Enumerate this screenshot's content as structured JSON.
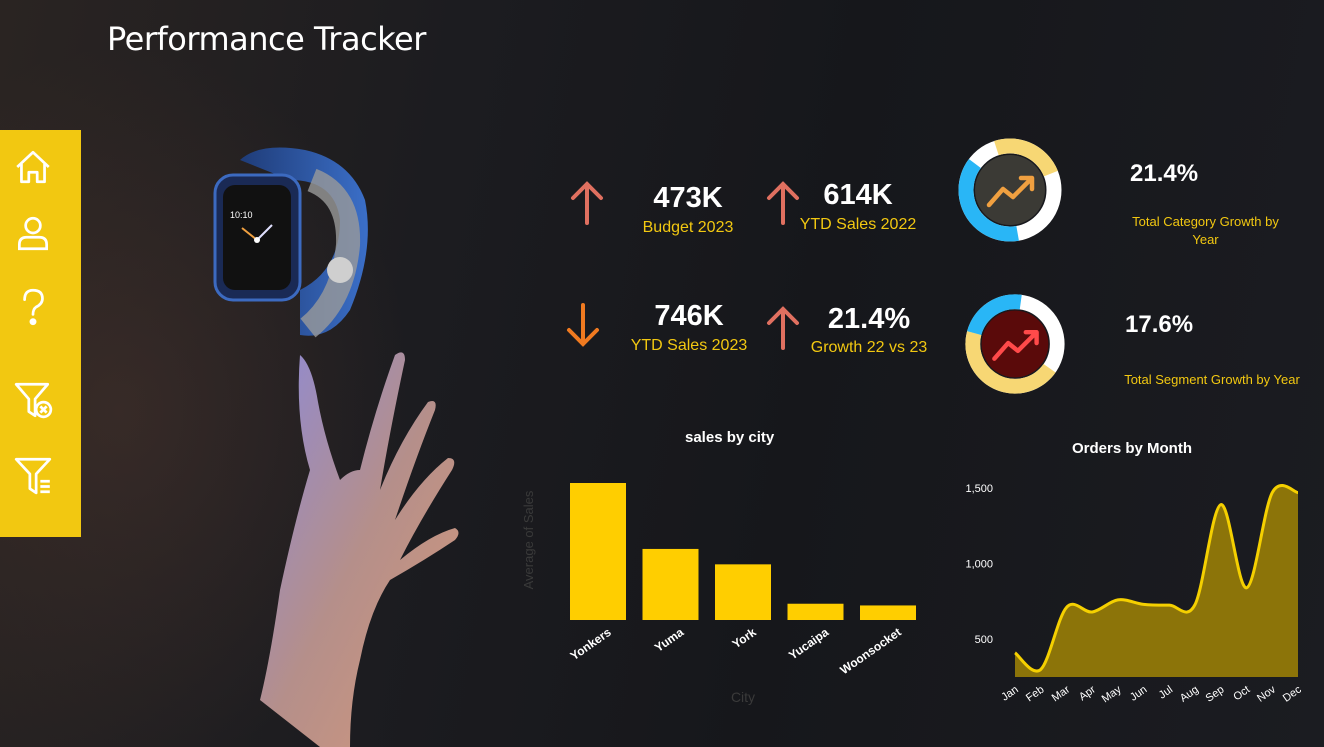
{
  "title": "Performance Tracker",
  "sidebar": {
    "items": [
      {
        "icon": "home-icon"
      },
      {
        "icon": "user-icon"
      },
      {
        "icon": "help-icon"
      },
      {
        "icon": "clear-filter-icon"
      },
      {
        "icon": "filter-icon"
      }
    ]
  },
  "kpis": [
    {
      "value": "473K",
      "label": "Budget 2023",
      "trend": "up"
    },
    {
      "value": "614K",
      "label": "YTD Sales 2022",
      "trend": "up"
    },
    {
      "value": "746K",
      "label": "YTD Sales 2023",
      "trend": "down"
    },
    {
      "value": "21.4%",
      "label": "Growth 22 vs 23",
      "trend": "up"
    }
  ],
  "growth": [
    {
      "value": "21.4%",
      "label_line1": "Total Category Growth by",
      "label_line2": "Year",
      "fraction": 0.214
    },
    {
      "value": "17.6%",
      "label_line1": "Total Segment Growth by Year",
      "label_line2": "",
      "fraction": 0.176
    }
  ],
  "colors": {
    "accent": "#f2c811",
    "bar": "#ffce00",
    "arrow_up": "#e07060",
    "arrow_down": "#f07a20",
    "donut_blue": "#29b6f6",
    "donut_yellow": "#f7d774",
    "area_fill": "#8c7409",
    "area_line": "#f5d000"
  },
  "chart_data": [
    {
      "type": "bar",
      "title": "sales by city",
      "xlabel": "City",
      "ylabel": "Average of Sales",
      "categories": [
        "Yonkers",
        "Yuma",
        "York",
        "Yucaipa",
        "Woonsocket"
      ],
      "values": [
        800,
        415,
        325,
        95,
        85
      ]
    },
    {
      "type": "area",
      "title": "Orders by Month",
      "categories": [
        "Jan",
        "Feb",
        "Mar",
        "Apr",
        "May",
        "Jun",
        "Jul",
        "Aug",
        "Sep",
        "Oct",
        "Nov",
        "Dec"
      ],
      "values": [
        410,
        300,
        710,
        680,
        760,
        730,
        725,
        730,
        1390,
        840,
        1470,
        1470
      ],
      "ylim": [
        250,
        1500
      ],
      "yticks": [
        "500",
        "1,000",
        "1,500"
      ],
      "ytick_values": [
        500,
        1000,
        1500
      ]
    }
  ]
}
